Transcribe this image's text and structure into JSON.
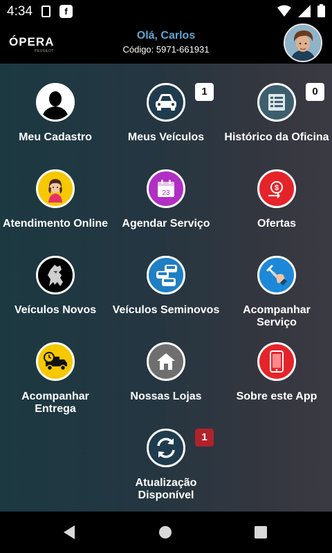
{
  "status_bar": {
    "time": "4:34",
    "icon_f": "f"
  },
  "header": {
    "logo": "ÓPERA",
    "logo_sub": "PEUGEOT",
    "greeting": "Olá, Carlos",
    "code": "Código: 5971-661931"
  },
  "tiles": [
    {
      "label": "Meu Cadastro",
      "icon": "person-silhouette-icon"
    },
    {
      "label": "Meus Veículos",
      "icon": "car-icon",
      "badge": "1"
    },
    {
      "label": "Histórico da Oficina",
      "icon": "history-list-icon",
      "badge": "0"
    },
    {
      "label": "Atendimento Online",
      "icon": "support-agent-icon"
    },
    {
      "label": "Agendar Serviço",
      "icon": "calendar-icon",
      "calendar_day": "23"
    },
    {
      "label": "Ofertas",
      "icon": "offers-icon"
    },
    {
      "label": "Veículos Novos",
      "icon": "peugeot-lion-icon"
    },
    {
      "label": "Veículos Seminovos",
      "icon": "used-cars-icon"
    },
    {
      "label": "Acompanhar Serviço",
      "icon": "wrench-hand-icon"
    },
    {
      "label": "Acompanhar Entrega",
      "icon": "delivery-truck-icon"
    },
    {
      "label": "Nossas Lojas",
      "icon": "store-icon"
    },
    {
      "label": "Sobre este App",
      "icon": "smartphone-icon"
    },
    {
      "label": "Atualização Disponível",
      "icon": "refresh-icon",
      "badge": "1"
    }
  ],
  "colors": {
    "accent_blue": "#5fa6d6",
    "badge_red": "#b1232b",
    "calendar_purple": "#b12fc4",
    "offers_red": "#e5242a",
    "tracking_blue": "#1e88d8",
    "truck_yellow": "#f5c800"
  }
}
